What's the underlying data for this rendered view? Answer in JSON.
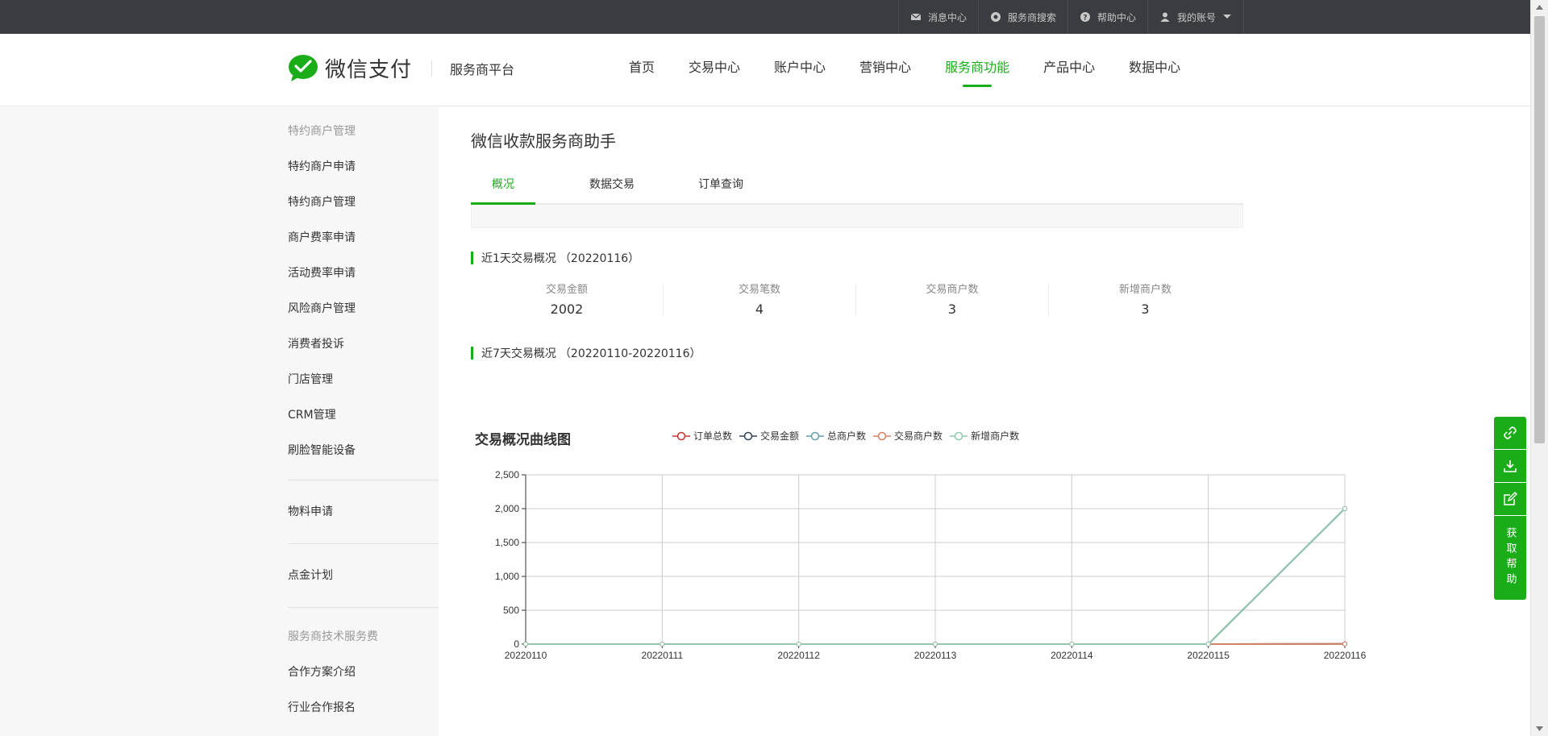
{
  "topbar": {
    "items": [
      {
        "label": "消息中心",
        "icon": "mail-icon"
      },
      {
        "label": "服务商搜索",
        "icon": "search-icon"
      },
      {
        "label": "帮助中心",
        "icon": "help-icon"
      },
      {
        "label": "我的账号",
        "icon": "user-icon"
      }
    ]
  },
  "header": {
    "logo_text": "微信支付",
    "platform": "服务商平台",
    "nav": [
      "首页",
      "交易中心",
      "账户中心",
      "营销中心",
      "服务商功能",
      "产品中心",
      "数据中心"
    ],
    "active_nav": "服务商功能"
  },
  "sidebar": {
    "group1_title": "特约商户管理",
    "group1_items": [
      "特约商户申请",
      "特约商户管理",
      "商户费率申请",
      "活动费率申请",
      "风险商户管理",
      "消费者投诉",
      "门店管理",
      "CRM管理",
      "刷脸智能设备"
    ],
    "item_materials": "物料申请",
    "item_dianjin": "点金计划",
    "group2_title": "服务商技术服务费",
    "group2_items": [
      "合作方案介绍",
      "行业合作报名"
    ]
  },
  "main": {
    "page_title": "微信收款服务商助手",
    "tabs": [
      "概况",
      "数据交易",
      "订单查询"
    ],
    "active_tab": "概况",
    "day_section_title": "近1天交易概况",
    "day_section_date": "（20220116）",
    "stats": [
      {
        "label": "交易金额",
        "value": "2002"
      },
      {
        "label": "交易笔数",
        "value": "4"
      },
      {
        "label": "交易商户数",
        "value": "3"
      },
      {
        "label": "新增商户数",
        "value": "3"
      }
    ],
    "week_section_title": "近7天交易概况",
    "week_section_date": "（20220110-20220116）"
  },
  "chart_data": {
    "type": "line",
    "title": "交易概况曲线图",
    "categories": [
      "20220110",
      "20220111",
      "20220112",
      "20220113",
      "20220114",
      "20220115",
      "20220116"
    ],
    "ylim": [
      0,
      2500
    ],
    "yticks": [
      "0",
      "500",
      "1,000",
      "1,500",
      "2,000",
      "2,500"
    ],
    "grid": true,
    "legend_position": "top",
    "series": [
      {
        "name": "订单总数",
        "color": "#c23531",
        "values": [
          0,
          0,
          0,
          0,
          0,
          0,
          4
        ]
      },
      {
        "name": "交易金额",
        "color": "#2f4554",
        "values": [
          0,
          0,
          0,
          0,
          0,
          0,
          2002
        ]
      },
      {
        "name": "总商户数",
        "color": "#61a0a8",
        "values": [
          0,
          0,
          0,
          0,
          0,
          0,
          3
        ]
      },
      {
        "name": "交易商户数",
        "color": "#d48265",
        "values": [
          0,
          0,
          0,
          0,
          0,
          0,
          3
        ]
      },
      {
        "name": "新增商户数",
        "color": "#91c7ae",
        "values": [
          0,
          0,
          0,
          0,
          0,
          0,
          2002
        ]
      }
    ]
  },
  "float_tools": {
    "help_label": "获取帮助",
    "icons": [
      "link-icon",
      "download-icon",
      "edit-icon"
    ]
  },
  "colors": {
    "accent": "#1aad19",
    "topbar": "#3a3c40"
  }
}
